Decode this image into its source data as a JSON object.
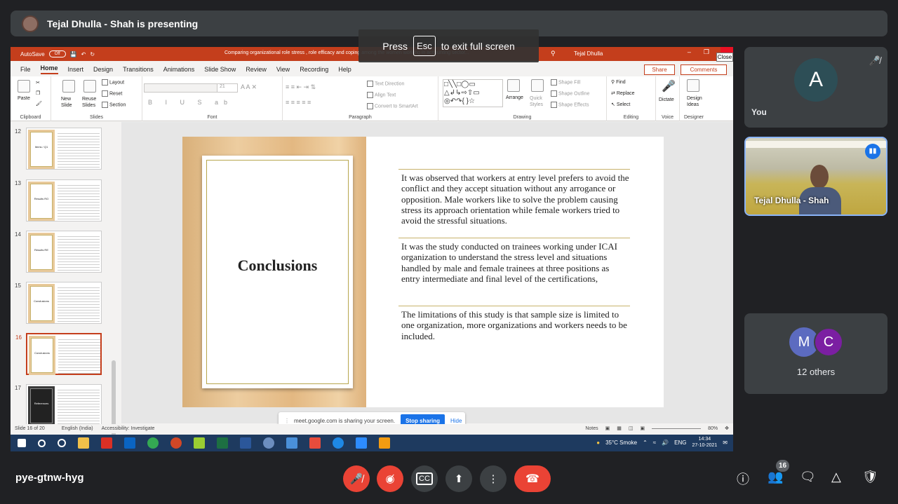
{
  "presenting_banner": "Tejal Dhulla - Shah is presenting",
  "fullscreen_notice": {
    "press": "Press",
    "key": "Esc",
    "rest": "to exit full screen"
  },
  "close_tooltip": "Close",
  "ppt": {
    "autosave": "AutoSave",
    "autosave_state": "Off",
    "doc_title": "Comparing organizational role stress , role efficacy and coping among the women working in accounting sector...",
    "user": "Tejal Dhulla",
    "tabs": [
      "File",
      "Home",
      "Insert",
      "Design",
      "Transitions",
      "Animations",
      "Slide Show",
      "Review",
      "View",
      "Recording",
      "Help"
    ],
    "share": "Share",
    "comments": "Comments",
    "ribbon": {
      "clipboard": {
        "paste": "Paste",
        "label": "Clipboard"
      },
      "slides": {
        "new_slide": "New Slide",
        "reuse_slides": "Reuse Slides",
        "layout": "Layout",
        "reset": "Reset",
        "section": "Section",
        "label": "Slides"
      },
      "font": {
        "label": "Font",
        "size": "21"
      },
      "paragraph": {
        "text_direction": "Text Direction",
        "align_text": "Align Text",
        "convert": "Convert to SmartArt",
        "label": "Paragraph"
      },
      "drawing": {
        "arrange": "Arrange",
        "quick_styles": "Quick Styles",
        "shape_fill": "Shape Fill",
        "shape_outline": "Shape Outline",
        "shape_effects": "Shape Effects",
        "label": "Drawing"
      },
      "editing": {
        "find": "Find",
        "replace": "Replace",
        "select": "Select",
        "label": "Editing"
      },
      "voice": {
        "dictate": "Dictate",
        "label": "Voice"
      },
      "designer": {
        "design_ideas": "Design Ideas",
        "label": "Designer"
      }
    },
    "thumbnails": [
      {
        "num": "12",
        "title": "Items / Q1"
      },
      {
        "num": "13",
        "title": "Results RO"
      },
      {
        "num": "14",
        "title": "Results RE"
      },
      {
        "num": "15",
        "title": "Conclusions"
      },
      {
        "num": "16",
        "title": "Conclusions"
      },
      {
        "num": "17",
        "title": "References"
      }
    ],
    "slide": {
      "title": "Conclusions",
      "paragraphs": [
        "It was observed that workers at entry level prefers to avoid the conflict and they accept situation without any arrogance or opposition. Male workers like to solve the problem causing stress its approach orientation while female workers tried to avoid the stressful situations.",
        "It was the study conducted on trainees working under ICAI organization to understand the stress level and situations handled by male and female trainees at three positions as entry intermediate and final level of the certifications,",
        "The limitations of this study is that sample size is limited to one organization, more organizations and workers needs to be included."
      ]
    },
    "share_bar": {
      "message": "meet.google.com is sharing your screen.",
      "stop": "Stop sharing",
      "hide": "Hide"
    },
    "status": {
      "slide_of": "Slide 16 of 20",
      "language": "English (India)",
      "accessibility": "Accessibility: Investigate",
      "notes": "Notes",
      "zoom": "80%"
    },
    "taskbar": {
      "weather": "35°C Smoke",
      "lang": "ENG",
      "time": "14:34",
      "date": "27-10-2021"
    }
  },
  "tiles": {
    "you": {
      "initial": "A",
      "name": "You"
    },
    "presenter": {
      "name": "Tejal Dhulla - Shah"
    },
    "others": {
      "initials": [
        "M",
        "C"
      ],
      "label": "12 others"
    }
  },
  "bottom": {
    "meeting_code": "pye-gtnw-hyg",
    "participants_count": "16"
  }
}
